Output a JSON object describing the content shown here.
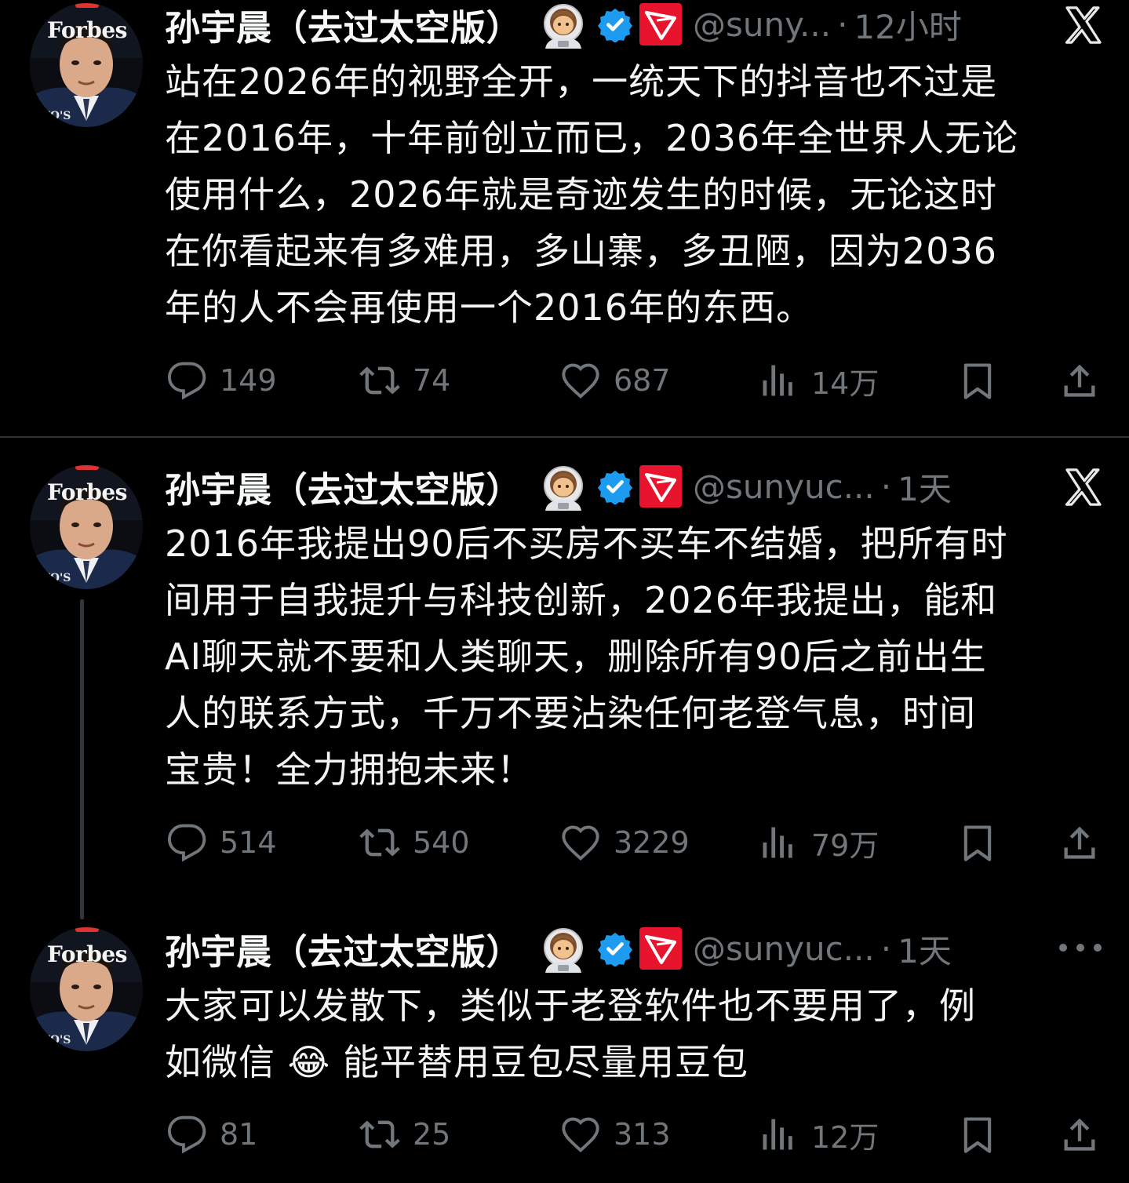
{
  "tweets": [
    {
      "avatar_text": "Forbes",
      "display_name": "孙宇晨（去过太空版）",
      "handle": "@suny...",
      "separator": "·",
      "time": "12小时",
      "text": "站在2026年的视野全开，一统天下的抖音也不过是\n在2016年，十年前创立而已，2036年全世界人无论\n使用什么，2026年就是奇迹发生的时候，无论这时\n在你看起来有多难用，多山寨，多丑陋，因为2036\n年的人不会再使用一个2016年的东西。",
      "stats": {
        "replies": "149",
        "retweets": "74",
        "likes": "687",
        "views": "14万"
      }
    },
    {
      "avatar_text": "Forbes",
      "display_name": "孙宇晨（去过太空版）",
      "handle": "@sunyuc...",
      "separator": "·",
      "time": "1天",
      "text": "2016年我提出90后不买房不买车不结婚，把所有时\n间用于自我提升与科技创新，2026年我提出，能和\nAI聊天就不要和人类聊天，删除所有90后之前出生\n人的联系方式，千万不要沾染任何老登气息，时间\n宝贵！全力拥抱未来！",
      "stats": {
        "replies": "514",
        "retweets": "540",
        "likes": "3229",
        "views": "79万"
      }
    },
    {
      "avatar_text": "Forbes",
      "display_name": "孙宇晨（去过太空版）",
      "handle": "@sunyuc...",
      "separator": "·",
      "time": "1天",
      "text": "大家可以发散下，类似于老登软件也不要用了，例\n如微信 😂 能平替用豆包尽量用豆包",
      "stats": {
        "replies": "81",
        "retweets": "25",
        "likes": "313",
        "views": "12万"
      }
    }
  ],
  "icons": {
    "reply": "reply-icon",
    "retweet": "retweet-icon",
    "like": "heart-icon",
    "views": "views-icon",
    "bookmark": "bookmark-icon",
    "share": "share-icon",
    "x_logo": "x-logo-icon",
    "more": "more-icon",
    "verified": "verified-badge-icon",
    "tron": "tron-logo-icon",
    "astronaut": "astronaut-emoji-icon"
  },
  "colors": {
    "background": "#000000",
    "text": "#e7e9ea",
    "muted": "#71767b",
    "verified": "#1d9bf0",
    "tron": "#e8132d"
  }
}
